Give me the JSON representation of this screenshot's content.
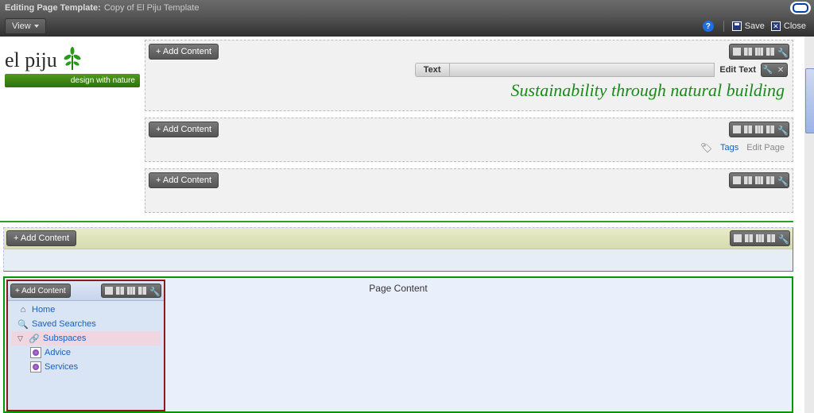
{
  "title_bar": {
    "label": "Editing Page Template:",
    "name": "Copy of El Piju Template"
  },
  "menu": {
    "view": "View",
    "save": "Save",
    "close": "Close"
  },
  "logo": {
    "name": "el piju",
    "tagline": "design with nature"
  },
  "buttons": {
    "add_content": "+ Add Content"
  },
  "region1": {
    "text_label": "Text",
    "edit_text": "Edit Text",
    "tagline": "Sustainability through natural building"
  },
  "region2": {
    "tags": "Tags",
    "edit_page": "Edit Page"
  },
  "page_content": "Page Content",
  "nav": {
    "home": "Home",
    "saved_searches": "Saved Searches",
    "subspaces": "Subspaces",
    "advice": "Advice",
    "services": "Services"
  }
}
